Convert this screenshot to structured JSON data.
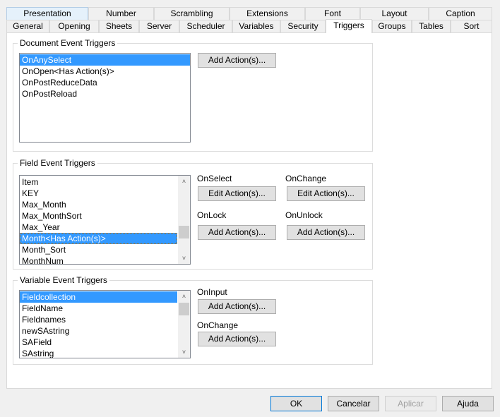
{
  "tabs_row1": [
    "Presentation",
    "Number",
    "Scrambling",
    "Extensions",
    "Font",
    "Layout",
    "Caption"
  ],
  "tabs_row2": [
    "General",
    "Opening",
    "Sheets",
    "Server",
    "Scheduler",
    "Variables",
    "Security",
    "Triggers",
    "Groups",
    "Tables",
    "Sort"
  ],
  "active_tab": "Triggers",
  "document": {
    "title": "Document Event Triggers",
    "items": [
      "OnAnySelect",
      "OnOpen<Has Action(s)>",
      "OnPostReduceData",
      "OnPostReload"
    ],
    "button": "Add Action(s)..."
  },
  "field": {
    "title": "Field Event Triggers",
    "items": [
      "Item",
      "KEY",
      "Max_Month",
      "Max_MonthSort",
      "Max_Year",
      "Month<Has Action(s)>",
      "Month_Sort",
      "MonthNum"
    ],
    "on_select": "OnSelect",
    "on_change": "OnChange",
    "on_lock": "OnLock",
    "on_unlock": "OnUnlock",
    "select_btn": "Edit Action(s)...",
    "change_btn": "Edit Action(s)...",
    "lock_btn": "Add Action(s)...",
    "unlock_btn": "Add Action(s)..."
  },
  "variable": {
    "title": "Variable Event Triggers",
    "items": [
      "Fieldcollection",
      "FieldName",
      "Fieldnames",
      "newSAstring",
      "SAField",
      "SAstring"
    ],
    "on_input": "OnInput",
    "on_change": "OnChange",
    "input_btn": "Add Action(s)...",
    "change_btn": "Add Action(s)..."
  },
  "footer": {
    "ok": "OK",
    "cancel": "Cancelar",
    "apply": "Aplicar",
    "help": "Ajuda"
  }
}
